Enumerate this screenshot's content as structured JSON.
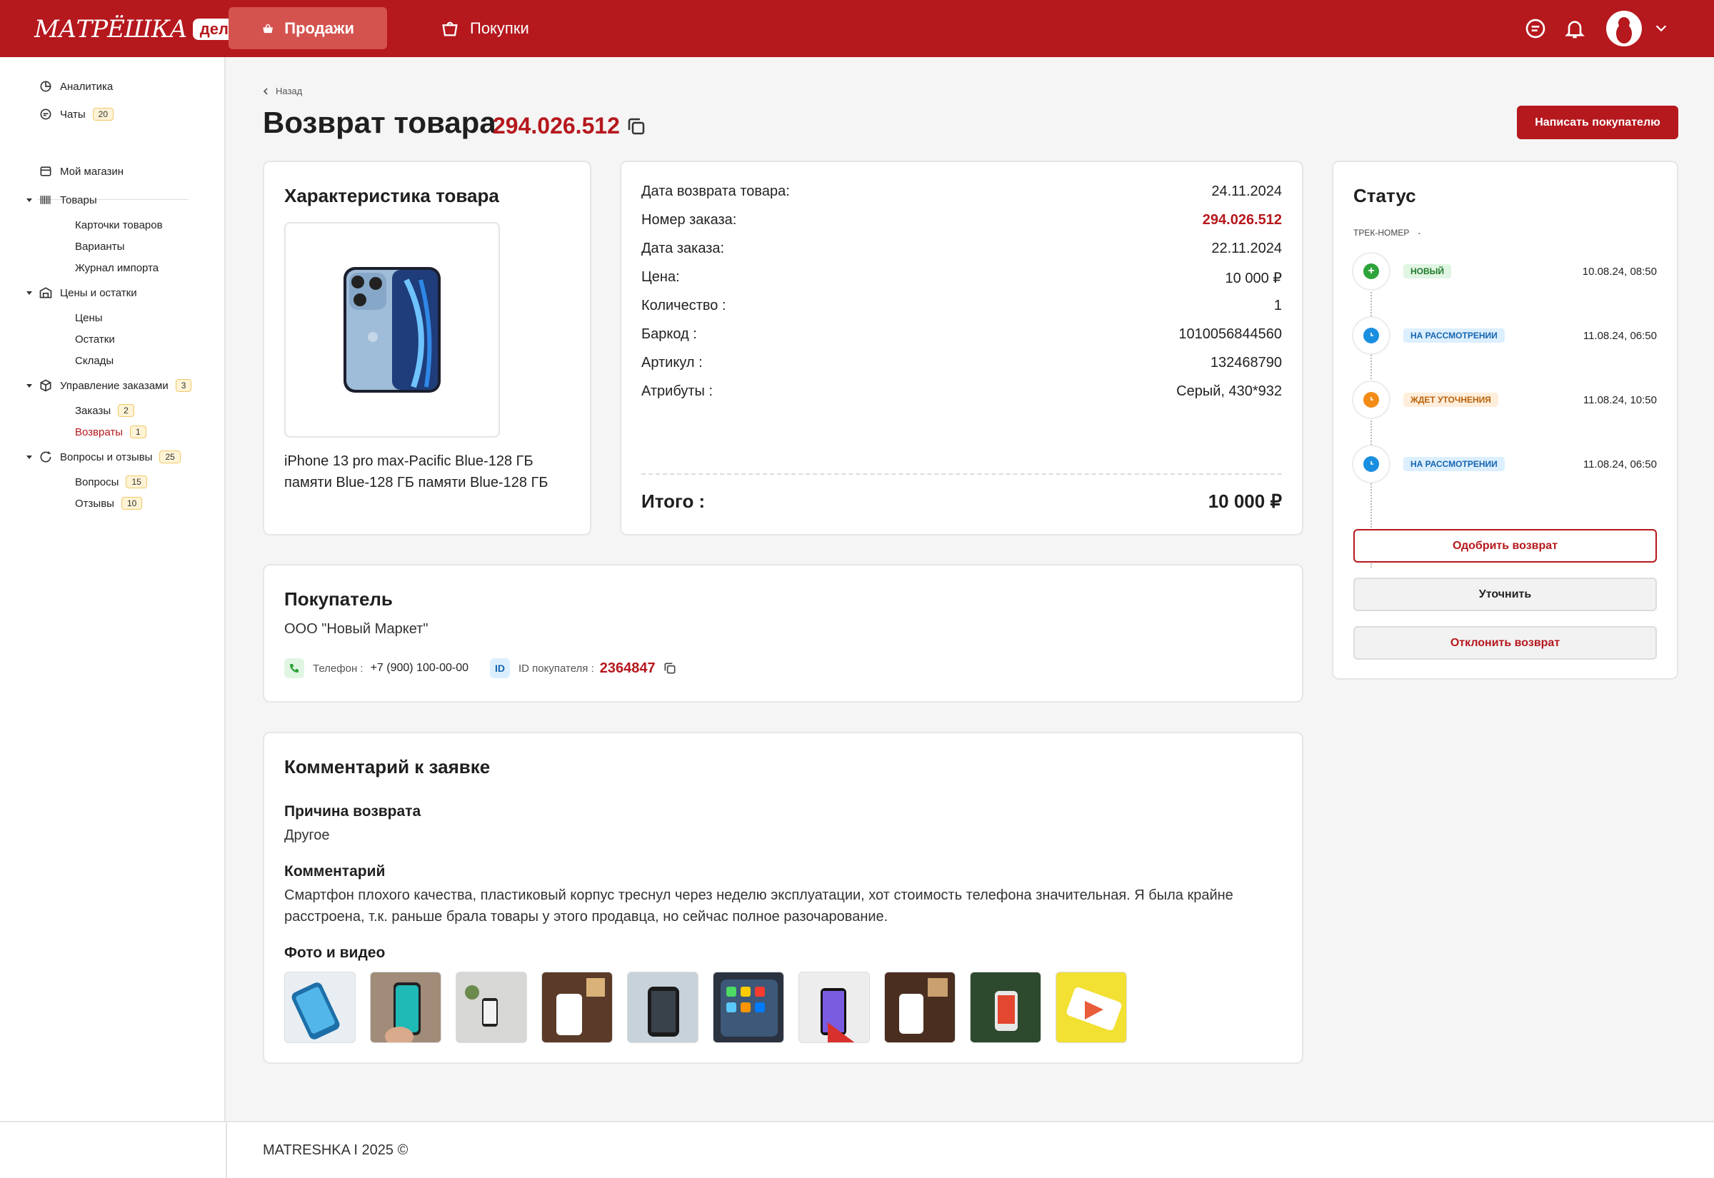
{
  "header": {
    "logo_text": "МАТРЁШКА",
    "logo_badge": "дело",
    "tabs": [
      {
        "label": "Продажи"
      },
      {
        "label": "Покупки"
      }
    ]
  },
  "sidebar": {
    "analytics": "Аналитика",
    "chats": {
      "label": "Чаты",
      "count": "20"
    },
    "my_shop": "Мой магазин",
    "goods": {
      "label": "Товары",
      "children": [
        "Карточки товаров",
        "Варианты",
        "Журнал импорта"
      ]
    },
    "prices": {
      "label": "Цены и остатки",
      "children": [
        "Цены",
        "Остатки",
        "Склады"
      ]
    },
    "orders": {
      "label": "Управление заказами",
      "count": "3",
      "children": [
        {
          "label": "Заказы",
          "count": "2"
        },
        {
          "label": "Возвраты",
          "count": "1"
        }
      ]
    },
    "questions": {
      "label": "Вопросы и отзывы",
      "count": "25",
      "children": [
        {
          "label": "Вопросы",
          "count": "15"
        },
        {
          "label": "Отзывы",
          "count": "10"
        }
      ]
    }
  },
  "page": {
    "back": "Назад",
    "title": "Возврат товара",
    "number": "294.026.512",
    "write_button": "Написать покупателю"
  },
  "product": {
    "title": "Характеристика товара",
    "name": "iPhone 13 pro max-Pacific Blue-128 ГБ памяти Blue-128 ГБ памяти Blue-128 ГБ"
  },
  "details": {
    "rows": [
      {
        "label": "Дата возврата товара:",
        "value": "24.11.2024"
      },
      {
        "label": "Номер заказа:",
        "value": "294.026.512"
      },
      {
        "label": "Дата заказа:",
        "value": "22.11.2024"
      },
      {
        "label": "Цена:",
        "value": "10 000 ₽"
      },
      {
        "label": "Количество :",
        "value": "1"
      },
      {
        "label": "Баркод :",
        "value": "1010056844560"
      },
      {
        "label": "Артикул :",
        "value": "132468790"
      },
      {
        "label": "Атрибуты :",
        "value": "Серый, 430*932"
      }
    ],
    "total_label": "Итого :",
    "total_value": "10 000 ₽"
  },
  "status": {
    "title": "Статус",
    "track_label": "ТРЕК-НОМЕР",
    "track_value": "-",
    "events": [
      {
        "badge": "НОВЫЙ",
        "time": "10.08.24, 08:50",
        "color": "#2ea43a",
        "bg": "#e1f5e3"
      },
      {
        "badge": "НА РАССМОТРЕНИИ",
        "time": "11.08.24, 06:50",
        "color": "#1a8fe0",
        "bg": "#dcefff"
      },
      {
        "badge": "ЖДЕТ УТОЧНЕНИЯ",
        "time": "11.08.24, 10:50",
        "color": "#f28b17",
        "bg": "#ffeedb"
      },
      {
        "badge": "НА РАССМОТРЕНИИ",
        "time": "11.08.24, 06:50",
        "color": "#1a8fe0",
        "bg": "#dcefff"
      }
    ],
    "approve": "Одобрить возврат",
    "clarify": "Уточнить",
    "reject": "Отклонить возврат"
  },
  "buyer": {
    "title": "Покупатель",
    "name": "ООО \"Новый Маркет\"",
    "phone_label": "Телефон :",
    "phone": "+7 (900) 100-00-00",
    "id_icon": "ID",
    "id_label": "ID покупателя :",
    "id_value": "2364847"
  },
  "comment": {
    "title": "Комментарий к заявке",
    "reason_title": "Причина возврата",
    "reason": "Другое",
    "comment_title": "Комментарий",
    "comment": "Смартфон плохого качества, пластиковый корпус треснул через неделю эксплуатации, хот стоимость телефона значительная. Я была крайне расстроена, т.к. раньше брала товары у этого продавца, но сейчас полное разочарование.",
    "media_title": "Фото и видео"
  },
  "footer": {
    "text": "MATRESHKA I 2025 ©"
  }
}
